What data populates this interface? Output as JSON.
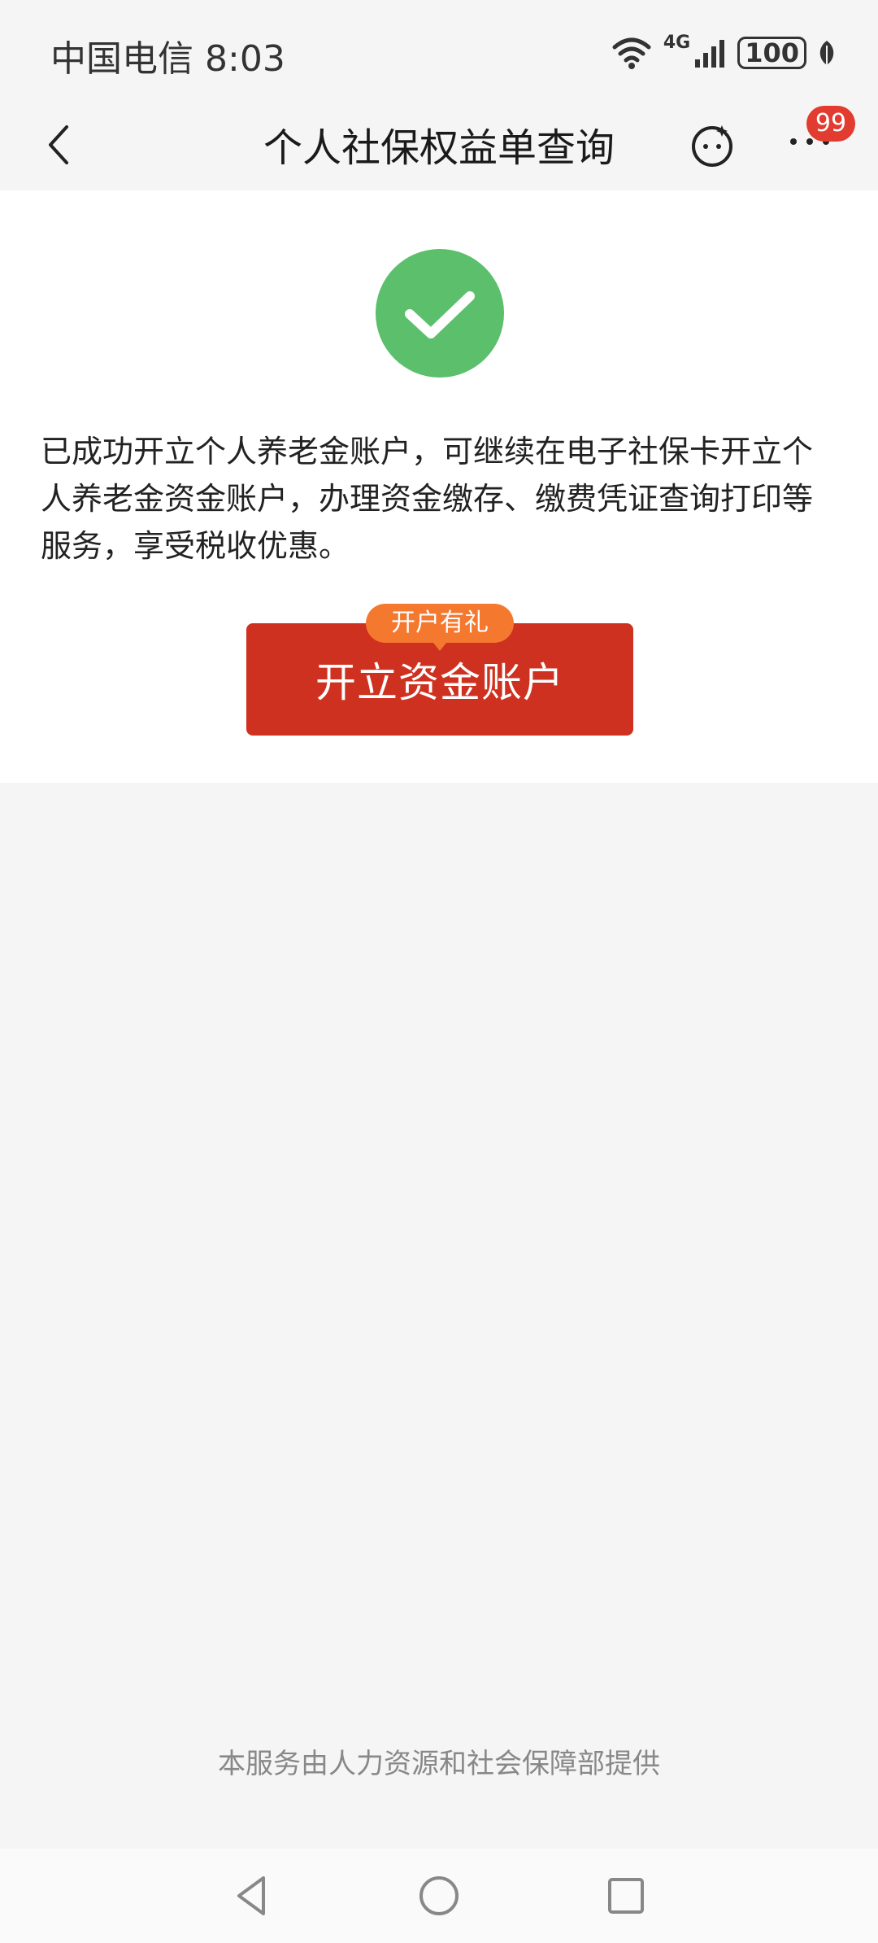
{
  "status_bar": {
    "carrier": "中国电信",
    "time": "8:03",
    "network": "4G",
    "battery": "100"
  },
  "nav": {
    "title": "个人社保权益单查询",
    "badge_count": "99"
  },
  "content": {
    "message": "已成功开立个人养老金账户，可继续在电子社保卡开立个人养老金资金账户，办理资金缴存、缴费凭证查询打印等服务，享受税收优惠。",
    "gift_tag": "开户有礼",
    "cta_label": "开立资金账户"
  },
  "footer": {
    "note": "本服务由人力资源和社会保障部提供"
  },
  "colors": {
    "success": "#5bbf6c",
    "cta": "#cf3120",
    "tag": "#f4792f",
    "badge": "#e23b30"
  }
}
